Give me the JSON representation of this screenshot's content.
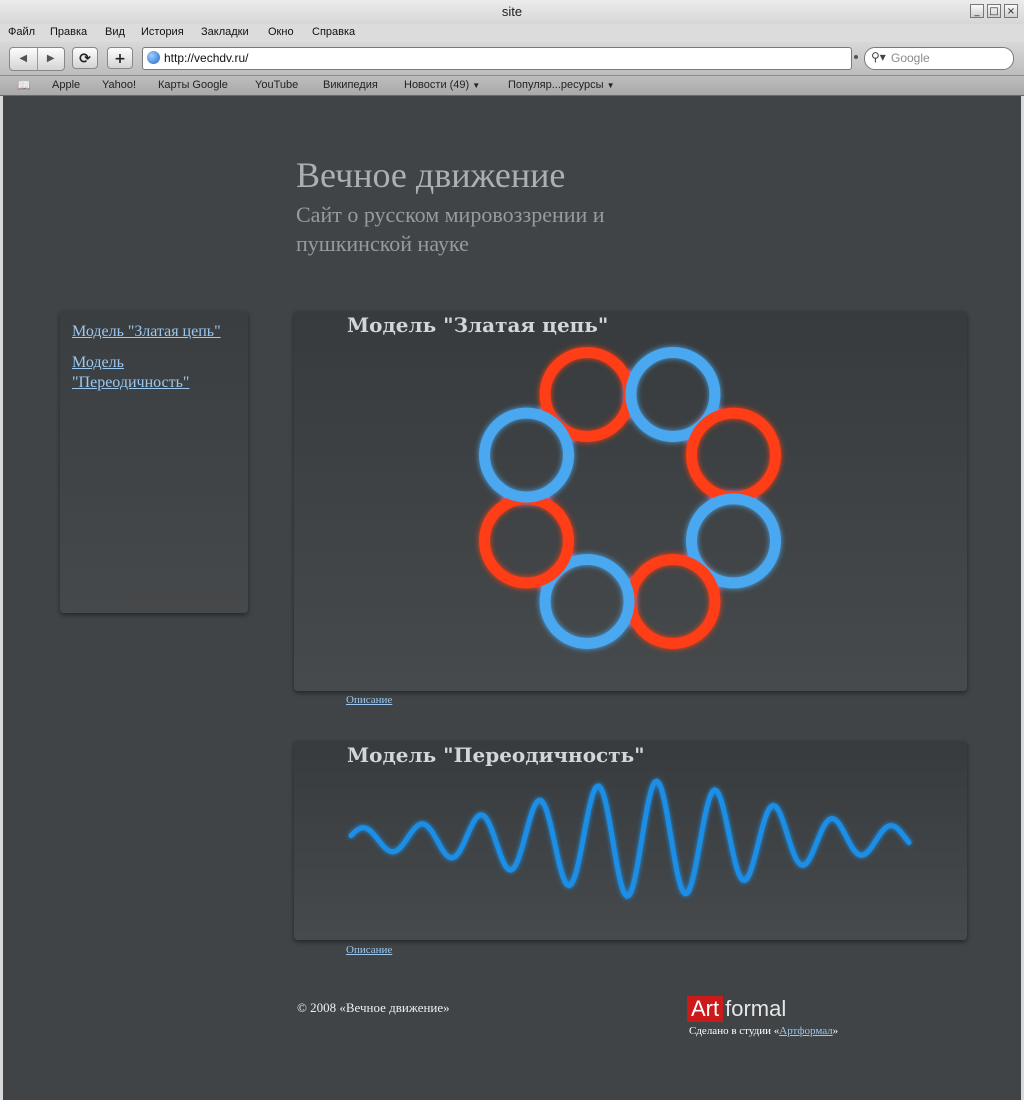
{
  "window": {
    "title": "site"
  },
  "menu": [
    "Файл",
    "Правка",
    "Вид",
    "История",
    "Закладки",
    "Окно",
    "Справка"
  ],
  "toolbar": {
    "back": "◀",
    "forward": "▶",
    "reload": "⟳",
    "add": "+",
    "url": "http://vechdv.ru/",
    "search_placeholder": "Google"
  },
  "bookmarks": [
    "Apple",
    "Yahoo!",
    "Карты Google",
    "YouTube",
    "Википедия",
    "Новости (49)",
    "Популяр...ресурсы"
  ],
  "site": {
    "title": "Вечное движение",
    "subtitle": "Сайт о русском мировоззрении и пушкинской науке"
  },
  "sidebar": {
    "links": [
      "Модель \"Златая цепь\"",
      "Модель \"Переодичность\""
    ]
  },
  "panels": [
    {
      "title": "Модель \"Златая цепь\"",
      "link": "Описание"
    },
    {
      "title": "Модель \"Переодичность\"",
      "link": "Описание"
    }
  ],
  "footer": {
    "copyright": "© 2008 «Вечное движение»",
    "logo_art": "Art",
    "logo_formal": "formal",
    "made_prefix": "Сделано в студии «",
    "studio": "Артформал",
    "made_suffix": "»"
  },
  "colors": {
    "ring_red": "#ff3d12",
    "ring_blue": "#4aa8ef",
    "wave_blue": "#1a8ee6"
  }
}
